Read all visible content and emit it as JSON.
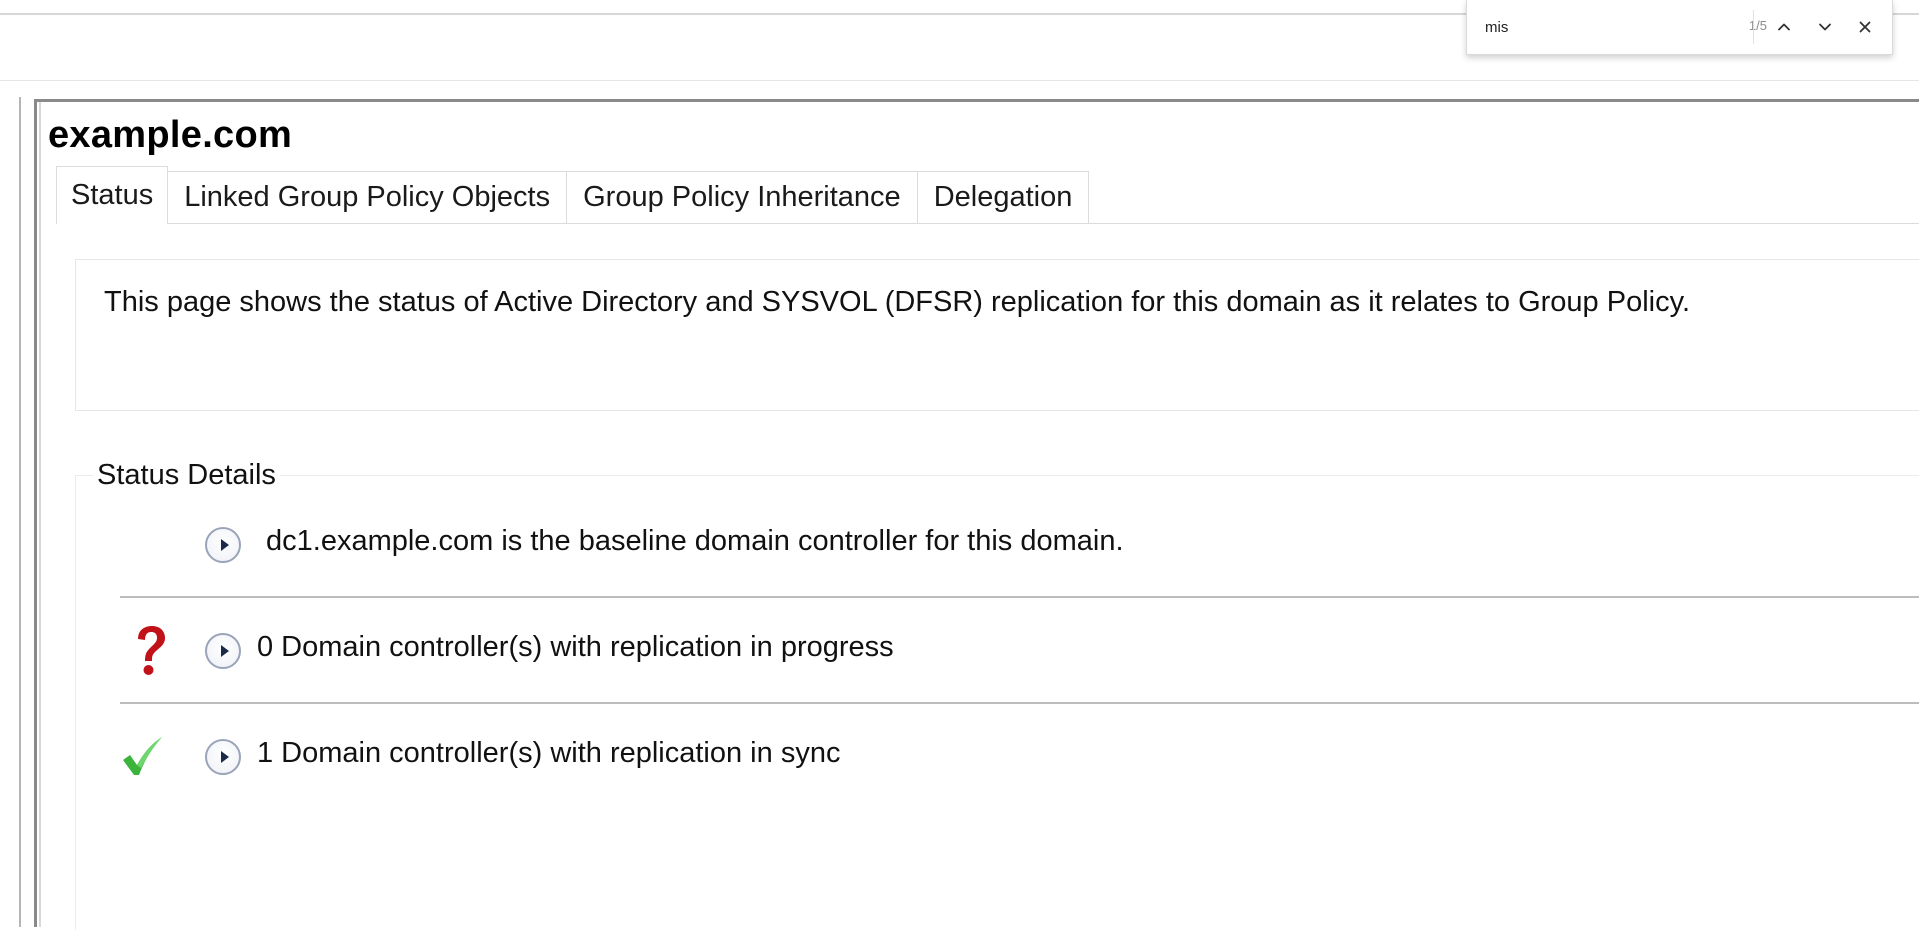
{
  "find_bar": {
    "query": "mis",
    "match_count": "1/5",
    "prev_icon": "chevron-up-icon",
    "next_icon": "chevron-down-icon",
    "close_icon": "close-icon"
  },
  "page": {
    "title": "example.com",
    "tabs": [
      {
        "label": "Status",
        "active": true
      },
      {
        "label": "Linked Group Policy Objects",
        "active": false
      },
      {
        "label": "Group Policy Inheritance",
        "active": false
      },
      {
        "label": "Delegation",
        "active": false
      }
    ],
    "intro": "This page shows the status of Active Directory and SYSVOL (DFSR) replication for this domain as it relates to Group Policy.",
    "details": {
      "legend": "Status Details",
      "rows": [
        {
          "icon": "none",
          "text": "dc1.example.com is the baseline domain controller for this domain."
        },
        {
          "icon": "question-mark-icon",
          "text": "0 Domain controller(s) with replication in progress"
        },
        {
          "icon": "checkmark-icon",
          "text": "1 Domain controller(s) with replication in sync"
        }
      ]
    }
  },
  "colors": {
    "question_red": "#c1121a",
    "check_green": "#3cb43c",
    "expand_border": "#9aa4b8"
  }
}
